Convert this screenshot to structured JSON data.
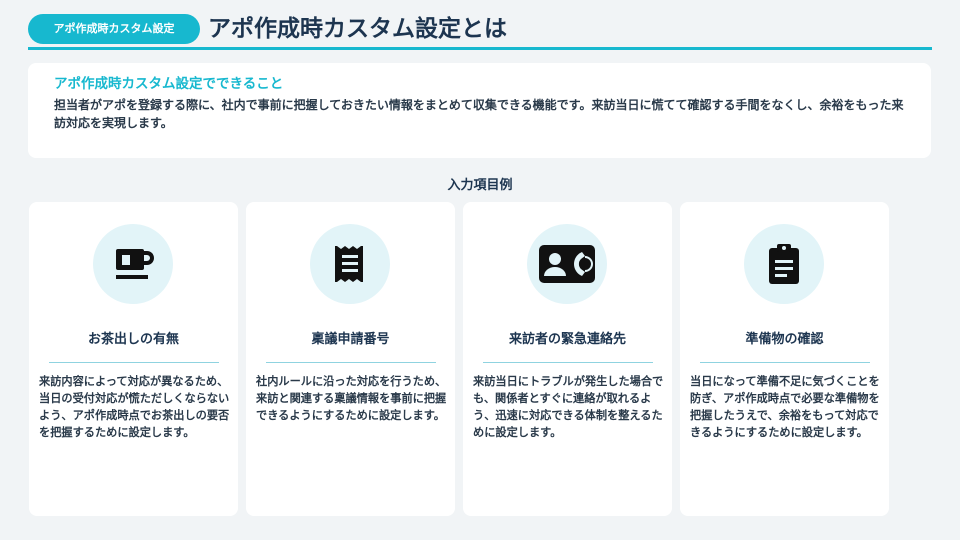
{
  "header": {
    "badge": "アポ作成時カスタム設定",
    "title": "アポ作成時カスタム設定とは"
  },
  "intro": {
    "title": "アポ作成時カスタム設定でできること",
    "text": "担当者がアポを登録する際に、社内で事前に把握しておきたい情報をまとめて収集できる機能です。来訪当日に慌てて確認する手間をなくし、余裕をもった来訪対応を実現します。"
  },
  "section_title": "入力項目例",
  "cards": [
    {
      "icon": "coffee-cup-icon",
      "title": "お茶出しの有無",
      "desc": "来訪内容によって対応が異なるため、当日の受付対応が慌ただしくならないよう、アポ作成時点でお茶出しの要否を把握するために設定します。"
    },
    {
      "icon": "receipt-icon",
      "title": "稟議申請番号",
      "desc": "社内ルールに沿った対応を行うため、来訪と関連する稟議情報を事前に把握できるようにするために設定します。"
    },
    {
      "icon": "contact-phone-icon",
      "title": "来訪者の緊急連絡先",
      "desc": "来訪当日にトラブルが発生した場合でも、関係者とすぐに連絡が取れるよう、迅速に対応できる体制を整えるために設定します。"
    },
    {
      "icon": "clipboard-icon",
      "title": "準備物の確認",
      "desc": "当日になって準備不足に気づくことを防ぎ、アポ作成時点で必要な準備物を把握したうえで、余裕をもって対応できるようにするために設定します。"
    }
  ],
  "colors": {
    "accent": "#17b8cf",
    "heading": "#1d3550",
    "icon_bg": "#e2f4f8",
    "icon_fg": "#111111"
  }
}
